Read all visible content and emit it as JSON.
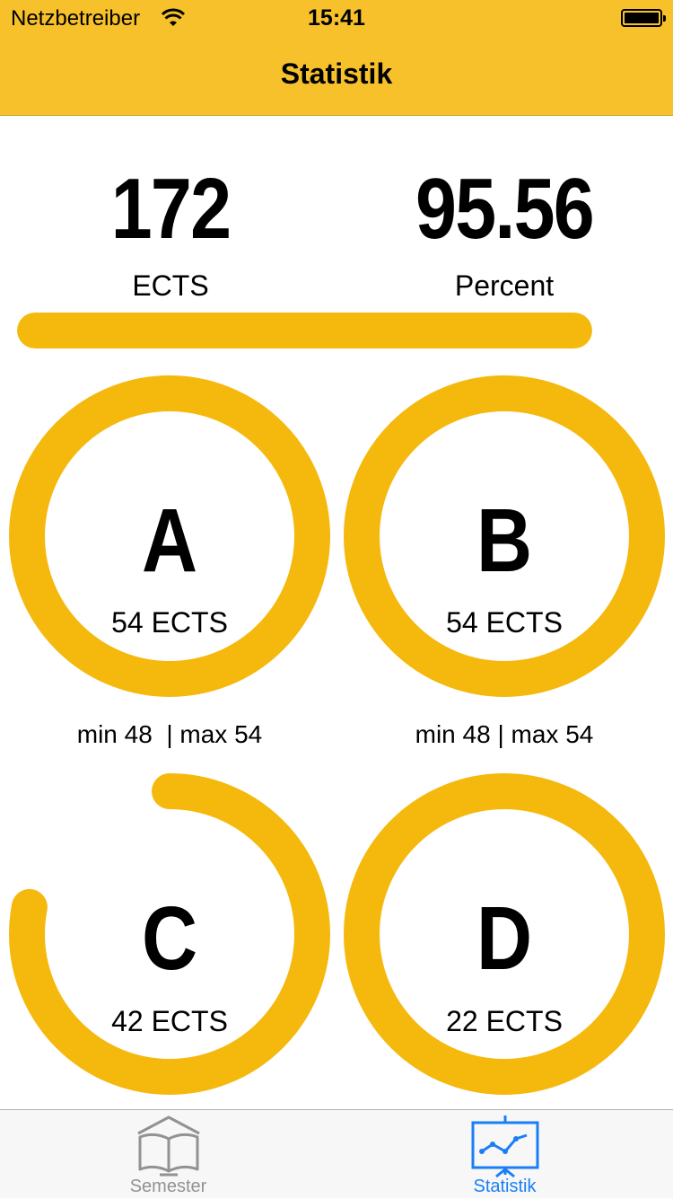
{
  "status_bar": {
    "carrier": "Netzbetreiber",
    "time": "15:41"
  },
  "nav": {
    "title": "Statistik"
  },
  "summary": {
    "ects_value": "172",
    "ects_label": "ECTS",
    "percent_value": "95.56",
    "percent_label": "Percent",
    "progress_fraction": 1.0
  },
  "rings": [
    {
      "letter": "A",
      "ects": "54 ECTS",
      "progress": 1.0,
      "minmax": "min 48  | max 54"
    },
    {
      "letter": "B",
      "ects": "54 ECTS",
      "progress": 1.0,
      "minmax": "min 48 | max 54"
    },
    {
      "letter": "C",
      "ects": "42 ECTS",
      "progress": 0.78
    },
    {
      "letter": "D",
      "ects": "22 ECTS",
      "progress": 1.0
    }
  ],
  "tabs": [
    {
      "label": "Semester",
      "icon": "book-icon",
      "selected": false
    },
    {
      "label": "Statistik",
      "icon": "chart-board-icon",
      "selected": true
    }
  ],
  "colors": {
    "accent": "#f5b80d",
    "bar_yellow": "#f7c12c",
    "tab_selected": "#1a7ff5",
    "tab_inactive": "#929292"
  }
}
